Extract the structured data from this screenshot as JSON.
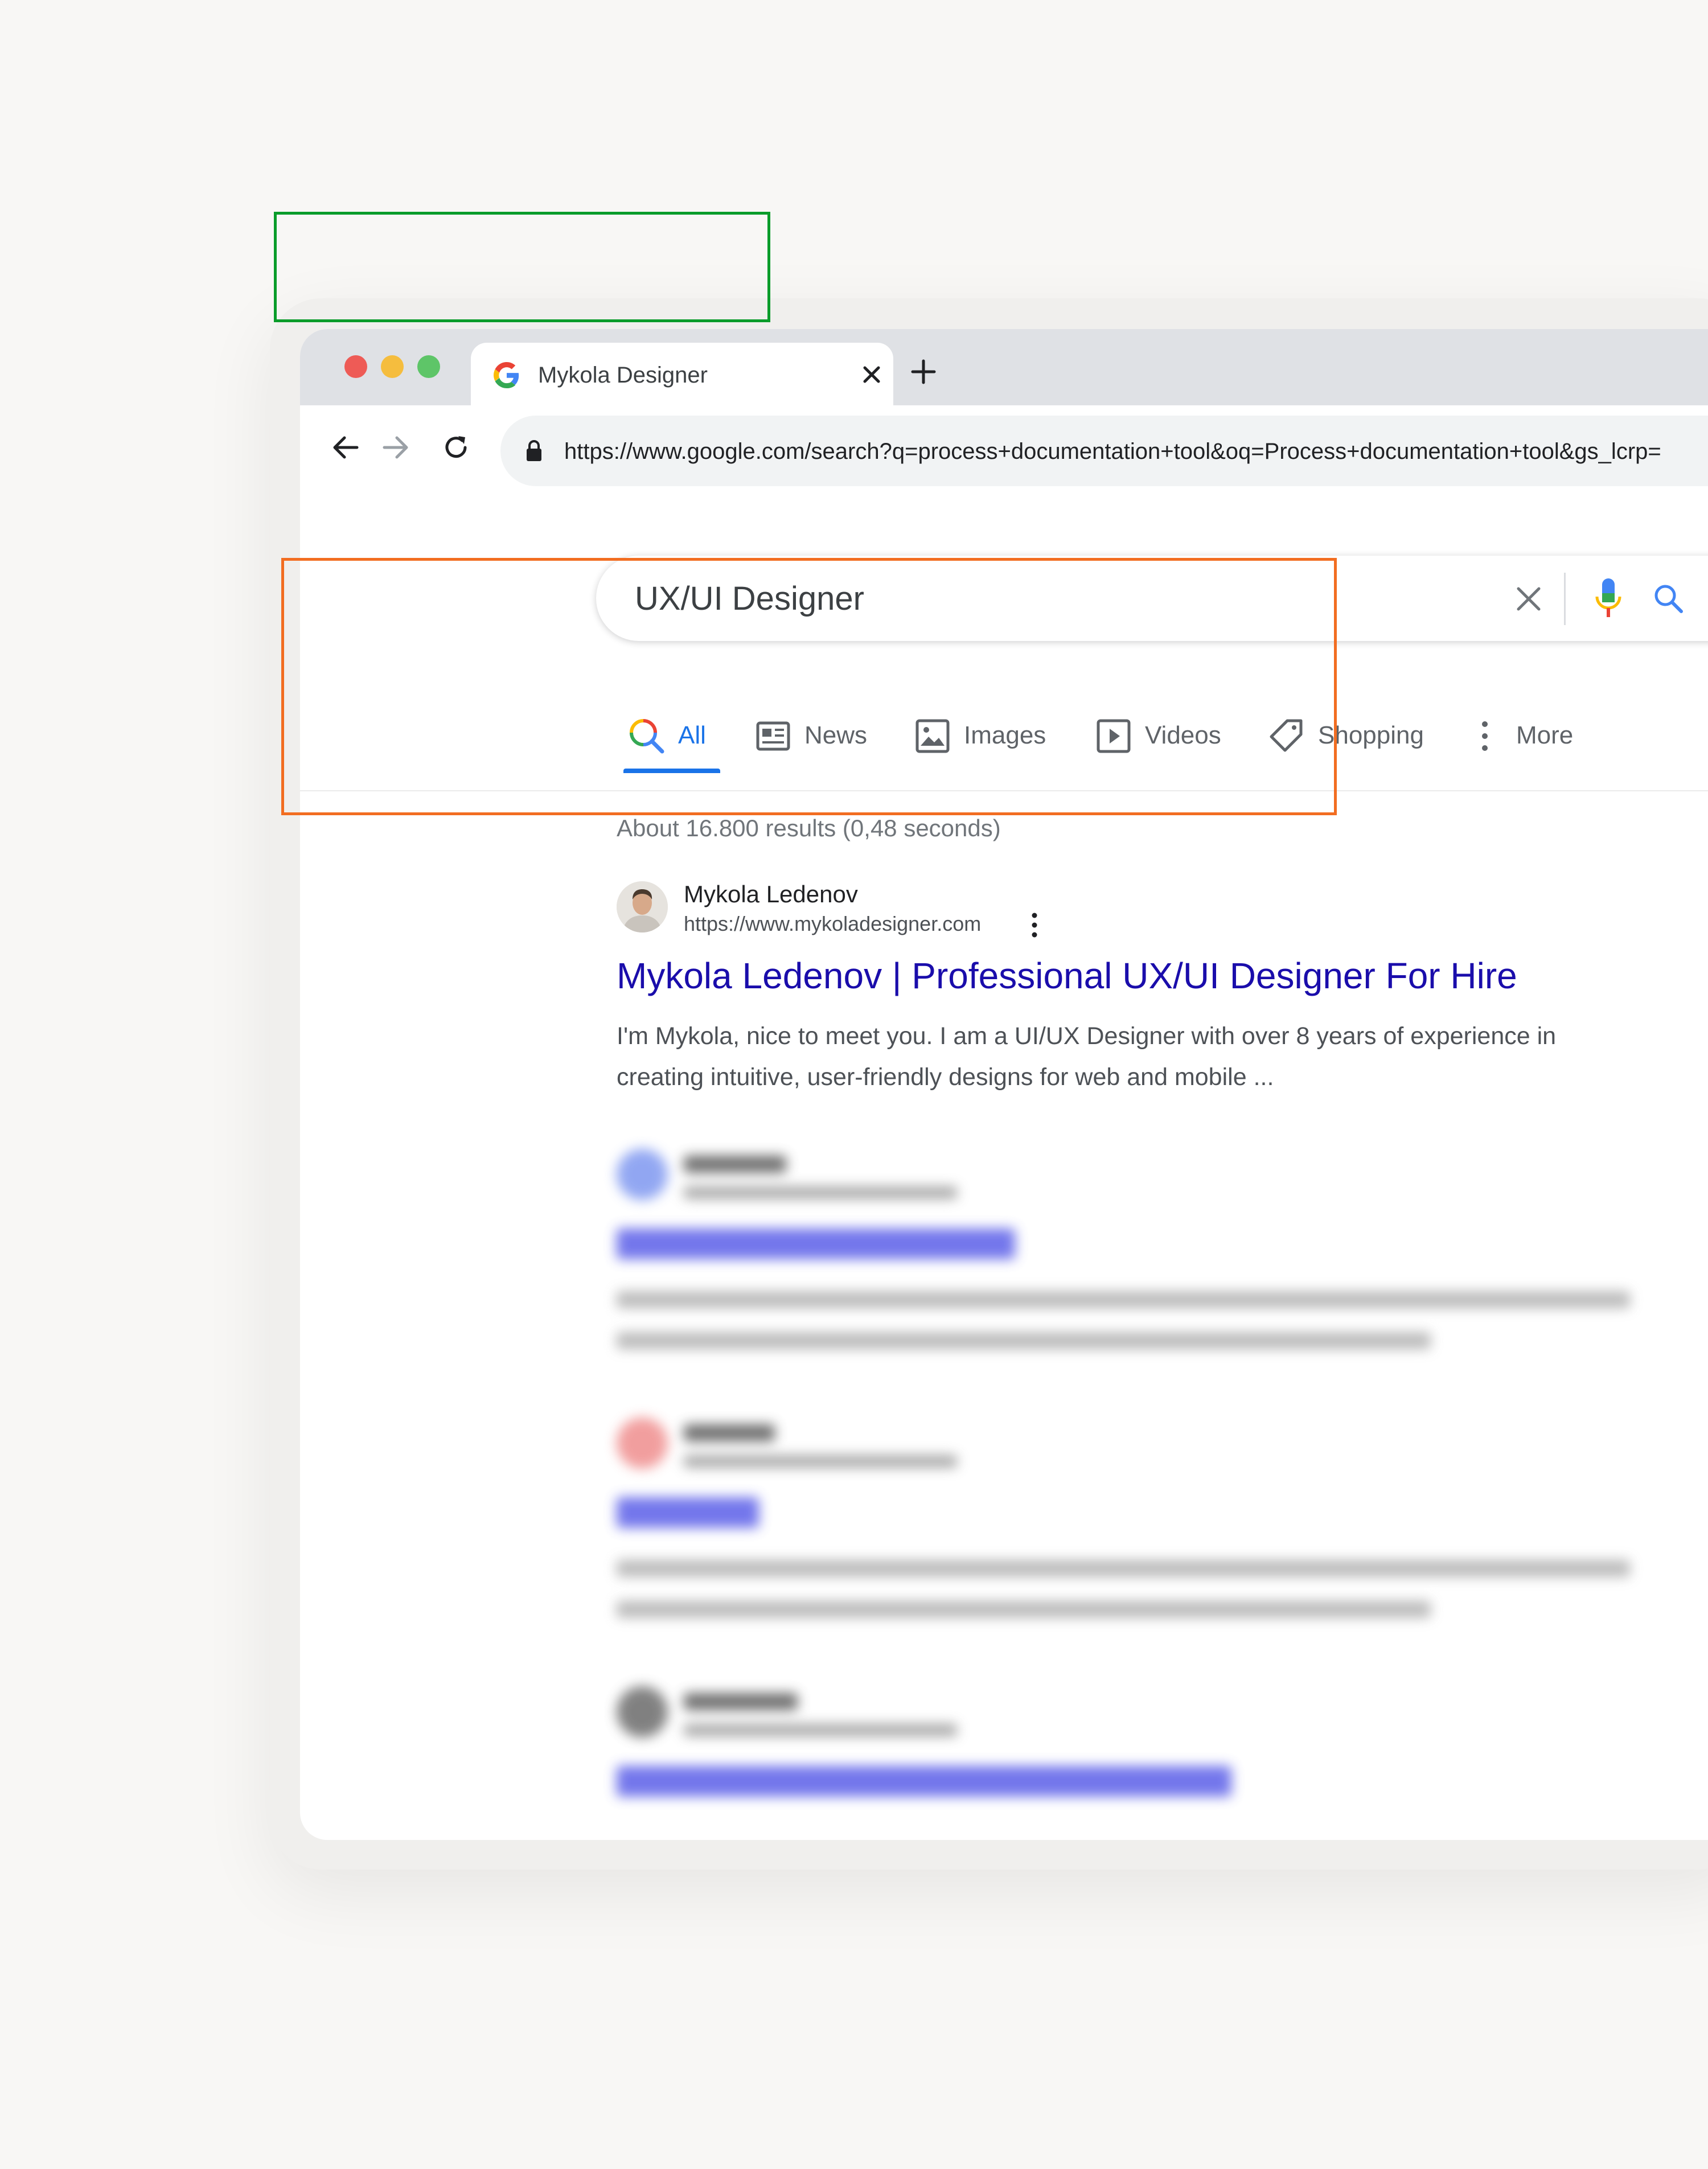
{
  "browser": {
    "tab": {
      "title": "Mykola Designer"
    },
    "address_bar": {
      "url": "https://www.google.com/search?q=process+documentation+tool&oq=Process+documentation+tool&gs_lcrp="
    }
  },
  "search": {
    "query": "UX/UI Designer"
  },
  "search_tabs": [
    {
      "label": "All",
      "icon": "search-icon",
      "active": true
    },
    {
      "label": "News",
      "icon": "news-icon",
      "active": false
    },
    {
      "label": "Images",
      "icon": "image-icon",
      "active": false
    },
    {
      "label": "Videos",
      "icon": "video-icon",
      "active": false
    },
    {
      "label": "Shopping",
      "icon": "tag-icon",
      "active": false
    },
    {
      "label": "More",
      "icon": "more-vert-icon",
      "active": false
    }
  ],
  "results_info": "About 16.800 results (0,48 seconds)",
  "results": [
    {
      "site_name": "Mykola Ledenov",
      "url": "https://www.mykoladesigner.com",
      "title": "Mykola Ledenov | Professional UX/UI Designer For Hire",
      "snippet": "I'm Mykola, nice to meet you. I am a UI/UX Designer with over 8 years of experience in creating intuitive, user-friendly designs for web and mobile ..."
    }
  ],
  "colors": {
    "link": "#1a0dab",
    "accent_blue": "#1a73e8",
    "highlight_green": "#0a9c2a",
    "highlight_orange": "#f26d21"
  }
}
